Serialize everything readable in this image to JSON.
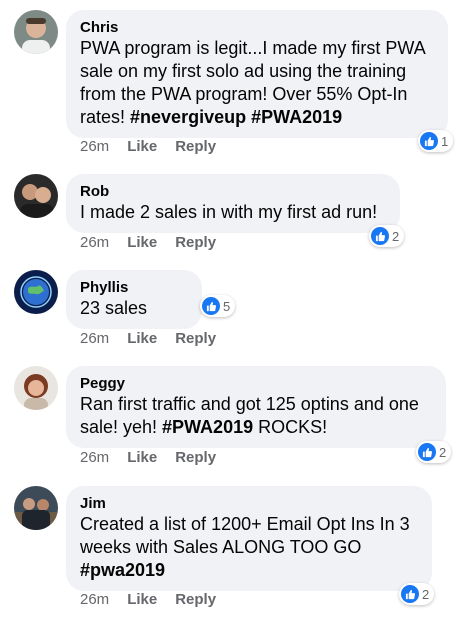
{
  "comments": [
    {
      "author": "Chris",
      "text_parts": [
        "PWA program is legit...I made my first PWA sale on my first solo ad using the training from the PWA program! Over 55% Opt-In rates! ",
        "#nevergiveup #PWA2019",
        ""
      ],
      "time": "26m",
      "like_label": "Like",
      "reply_label": "Reply",
      "reactions": "1"
    },
    {
      "author": "Rob",
      "text_parts": [
        "I made 2 sales in with my first ad run!",
        "",
        ""
      ],
      "time": "26m",
      "like_label": "Like",
      "reply_label": "Reply",
      "reactions": "2"
    },
    {
      "author": "Phyllis",
      "text_parts": [
        "23 sales",
        "",
        ""
      ],
      "time": "26m",
      "like_label": "Like",
      "reply_label": "Reply",
      "reactions": "5"
    },
    {
      "author": "Peggy",
      "text_parts": [
        "Ran first traffic and got 125 optins and one sale! yeh! ",
        "#PWA2019",
        " ROCKS!"
      ],
      "time": "26m",
      "like_label": "Like",
      "reply_label": "Reply",
      "reactions": "2"
    },
    {
      "author": "Jim",
      "text_parts": [
        "Created a list of 1200+ Email Opt Ins In 3 weeks with Sales ALONG TOO GO ",
        "#pwa2019",
        ""
      ],
      "time": "26m",
      "like_label": "Like",
      "reply_label": "Reply",
      "reactions": "2"
    }
  ],
  "colors": {
    "bubble": "#f0f2f5",
    "meta": "#65676b",
    "like_blue": "#1877f2"
  },
  "icons": [
    "like-thumb-icon"
  ]
}
